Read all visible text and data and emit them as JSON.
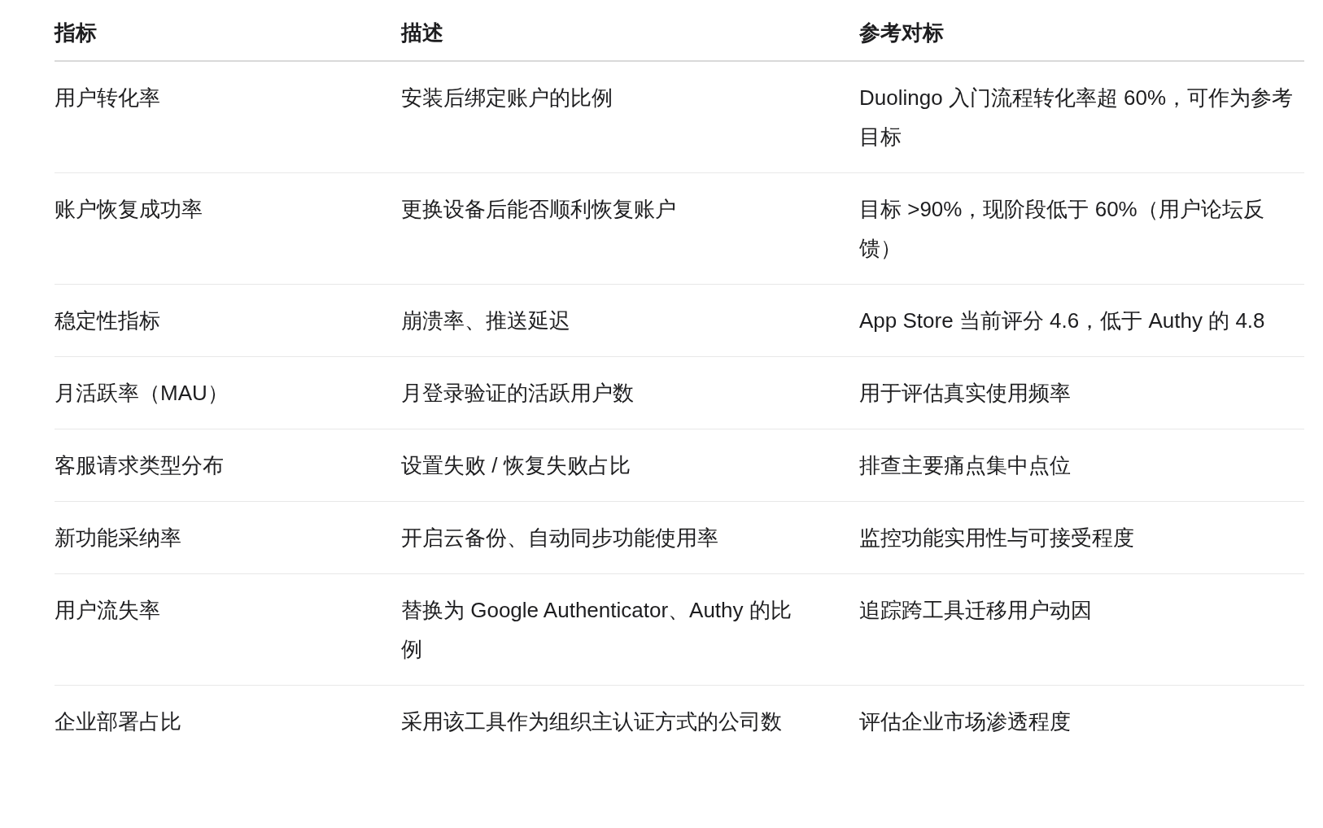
{
  "table": {
    "columns": [
      "指标",
      "描述",
      "参考对标"
    ],
    "rows": [
      [
        "用户转化率",
        "安装后绑定账户的比例",
        "Duolingo 入门流程转化率超 60%，可作为参考目标"
      ],
      [
        "账户恢复成功率",
        "更换设备后能否顺利恢复账户",
        "目标 >90%，现阶段低于 60%（用户论坛反馈）"
      ],
      [
        "稳定性指标",
        "崩溃率、推送延迟",
        "App Store 当前评分 4.6，低于 Authy 的 4.8"
      ],
      [
        "月活跃率（MAU）",
        "月登录验证的活跃用户数",
        "用于评估真实使用频率"
      ],
      [
        "客服请求类型分布",
        "设置失败 / 恢复失败占比",
        "排查主要痛点集中点位"
      ],
      [
        "新功能采纳率",
        "开启云备份、自动同步功能使用率",
        "监控功能实用性与可接受程度"
      ],
      [
        "用户流失率",
        "替换为 Google Authenticator、Authy 的比例",
        "追踪跨工具迁移用户动因"
      ],
      [
        "企业部署占比",
        "采用该工具作为组织主认证方式的公司数",
        "评估企业市场渗透程度"
      ]
    ]
  }
}
